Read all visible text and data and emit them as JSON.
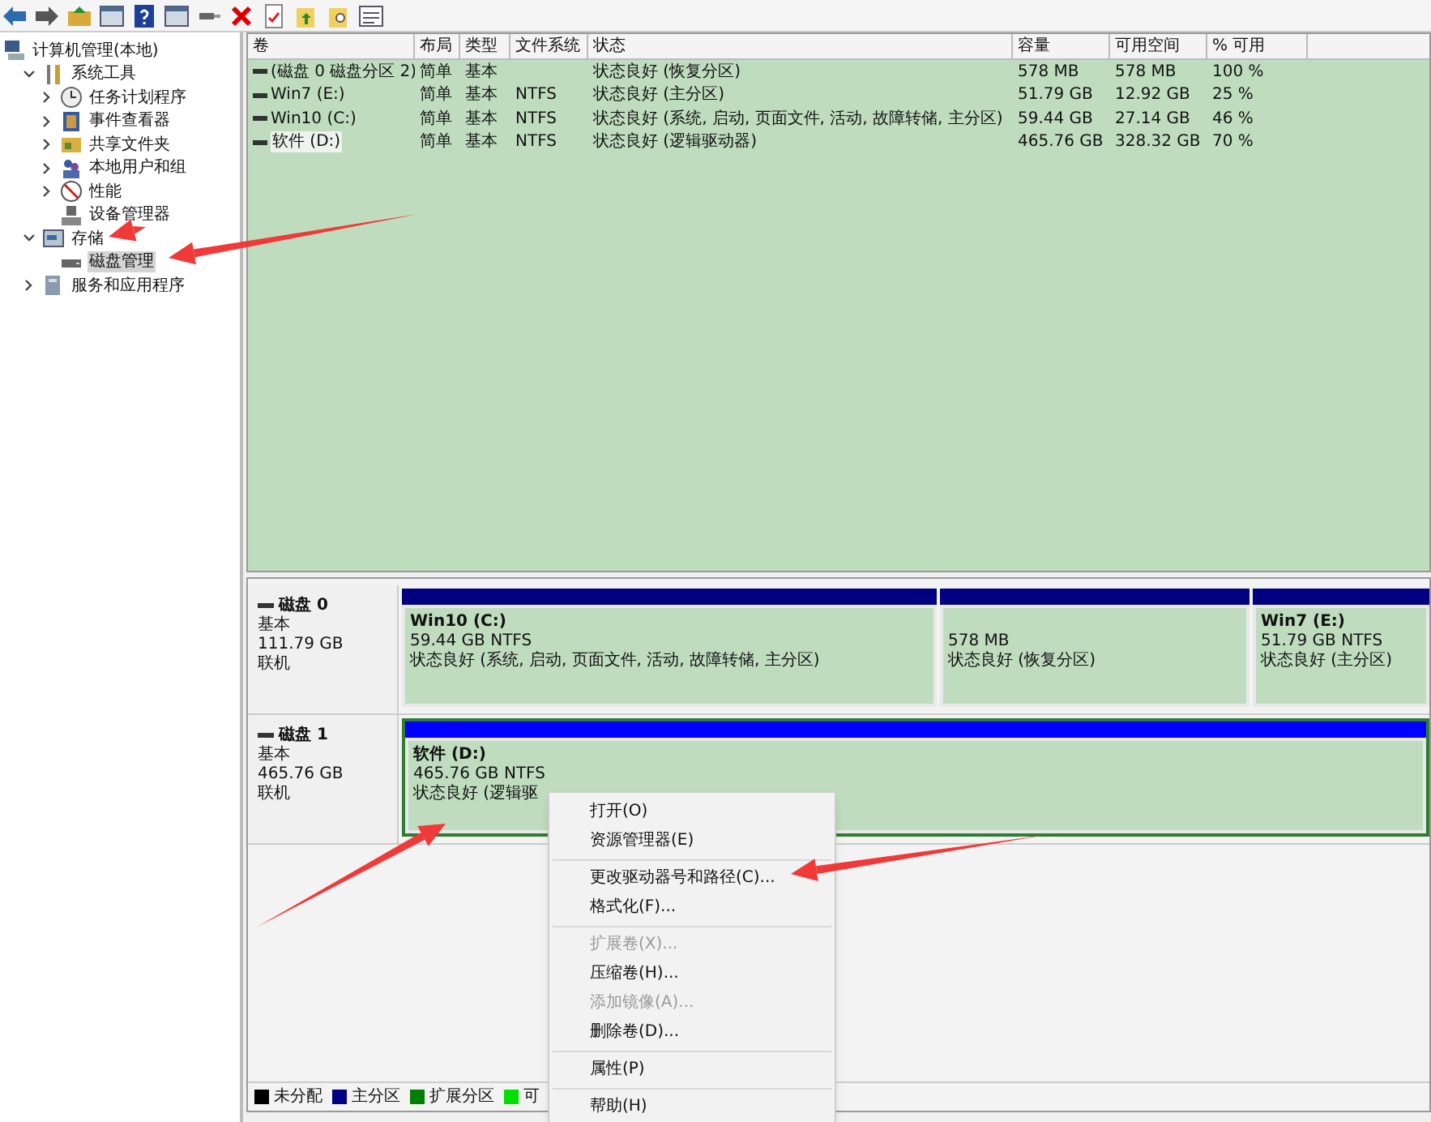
{
  "tree": [
    {
      "label": "计算机管理(本地)",
      "selected": false,
      "children": [
        {
          "label": "系统工具",
          "expanded": true,
          "selected": false,
          "children": [
            {
              "label": "任务计划程序",
              "expanded": false,
              "selected": false
            },
            {
              "label": "事件查看器",
              "expanded": false,
              "selected": false
            },
            {
              "label": "共享文件夹",
              "expanded": false,
              "selected": false
            },
            {
              "label": "本地用户和组",
              "expanded": false,
              "selected": false
            },
            {
              "label": "性能",
              "expanded": false,
              "selected": false
            },
            {
              "label": "设备管理器",
              "selected": false
            }
          ]
        },
        {
          "label": "存储",
          "expanded": true,
          "selected": false,
          "children": [
            {
              "label": "磁盘管理",
              "selected": true
            }
          ]
        },
        {
          "label": "服务和应用程序",
          "expanded": false,
          "selected": false
        }
      ]
    }
  ],
  "table": {
    "columns": [
      "卷",
      "布局",
      "类型",
      "文件系统",
      "状态",
      "容量",
      "可用空间",
      "% 可用"
    ],
    "rows": [
      {
        "cells": [
          "(磁盘 0 磁盘分区 2)",
          "简单",
          "基本",
          "",
          "状态良好 (恢复分区)",
          "578 MB",
          "578 MB",
          "100 %"
        ],
        "selected": false
      },
      {
        "cells": [
          "Win7 (E:)",
          "简单",
          "基本",
          "NTFS",
          "状态良好 (主分区)",
          "51.79 GB",
          "12.92 GB",
          "25 %"
        ],
        "selected": false
      },
      {
        "cells": [
          "Win10 (C:)",
          "简单",
          "基本",
          "NTFS",
          "状态良好 (系统, 启动, 页面文件, 活动, 故障转储, 主分区)",
          "59.44 GB",
          "27.14 GB",
          "46 %"
        ],
        "selected": false
      },
      {
        "cells": [
          "软件 (D:)",
          "简单",
          "基本",
          "NTFS",
          "状态良好 (逻辑驱动器)",
          "465.76 GB",
          "328.32 GB",
          "70 %"
        ],
        "selected": true
      }
    ]
  },
  "disks": [
    {
      "name": "磁盘 0",
      "type": "基本",
      "size": "111.79 GB",
      "status": "联机",
      "partitions": [
        {
          "name": "Win10  (C:)",
          "size": "59.44 GB NTFS",
          "status": "状态良好 (系统, 启动, 页面文件, 活动, 故障转储, 主分区)",
          "color": "#000080",
          "selected": false
        },
        {
          "size": "578 MB",
          "status": "状态良好 (恢复分区)",
          "color": "#000080",
          "selected": false
        },
        {
          "name": "Win7  (E:)",
          "size": "51.79 GB NTFS",
          "status": "状态良好 (主分区)",
          "color": "#000080",
          "selected": false
        }
      ]
    },
    {
      "name": "磁盘 1",
      "type": "基本",
      "size": "465.76 GB",
      "status": "联机",
      "partitions": [
        {
          "name": "软件  (D:)",
          "size": "465.76 GB NTFS",
          "status": "状态良好 (逻辑驱",
          "color": "#0000ff",
          "selected": true
        }
      ]
    }
  ],
  "legend": [
    {
      "label": "未分配",
      "color": "#000000"
    },
    {
      "label": "主分区",
      "color": "#000080"
    },
    {
      "label": "扩展分区",
      "color": "#008000"
    },
    {
      "label": "可",
      "color": "#00e000"
    }
  ],
  "context_menu": [
    [
      {
        "label": "打开(O)",
        "disabled": false
      },
      {
        "label": "资源管理器(E)",
        "disabled": false
      }
    ],
    [
      {
        "label": "更改驱动器号和路径(C)...",
        "disabled": false
      },
      {
        "label": "格式化(F)...",
        "disabled": false
      }
    ],
    [
      {
        "label": "扩展卷(X)...",
        "disabled": true
      },
      {
        "label": "压缩卷(H)...",
        "disabled": false
      },
      {
        "label": "添加镜像(A)...",
        "disabled": true
      },
      {
        "label": "删除卷(D)...",
        "disabled": false
      }
    ],
    [
      {
        "label": "属性(P)",
        "disabled": false
      }
    ],
    [
      {
        "label": "帮助(H)",
        "disabled": false
      }
    ]
  ]
}
